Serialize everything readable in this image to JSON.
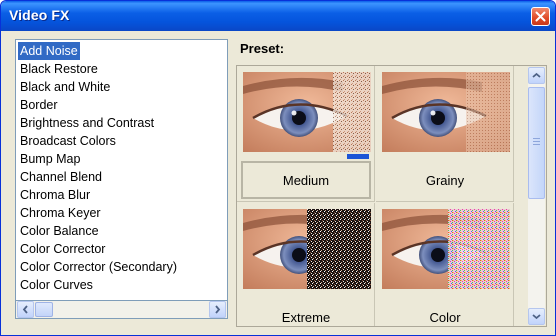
{
  "window": {
    "title": "Video FX"
  },
  "effects": {
    "items": [
      "Add Noise",
      "Black Restore",
      "Black and White",
      "Border",
      "Brightness and Contrast",
      "Broadcast Colors",
      "Bump Map",
      "Channel Blend",
      "Chroma Blur",
      "Chroma Keyer",
      "Color Balance",
      "Color Corrector",
      "Color Corrector (Secondary)",
      "Color Curves"
    ],
    "selected": "Add Noise"
  },
  "preset": {
    "label": "Preset:",
    "tiles": [
      {
        "caption": "Medium"
      },
      {
        "caption": "Grainy"
      },
      {
        "caption": "Extreme"
      },
      {
        "caption": "Color"
      }
    ],
    "selected": "Medium"
  },
  "colors": {
    "title_bar": "#0a5fe8",
    "selection": "#316ac5",
    "window_bg": "#ece9d8"
  },
  "icons": {
    "close": "close-icon",
    "scroll_left": "arrow-left-icon",
    "scroll_right": "arrow-right-icon",
    "scroll_up": "arrow-up-icon",
    "scroll_down": "arrow-down-icon"
  }
}
